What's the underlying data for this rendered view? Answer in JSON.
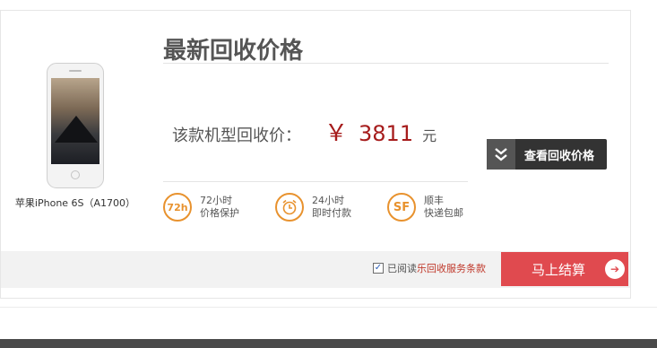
{
  "product": {
    "name": "苹果iPhone 6S（A1700）"
  },
  "title": "最新回收价格",
  "price": {
    "label": "该款机型回收价：",
    "symbol": "￥",
    "value": "3811",
    "unit": "元"
  },
  "check_button": {
    "icon": "double-chevron-down-icon",
    "label": "查看回收价格"
  },
  "features": [
    {
      "icon": "72h-icon",
      "icon_text": "72h",
      "line1": "72小时",
      "line2": "价格保护"
    },
    {
      "icon": "alarm-clock-icon",
      "icon_text": "⏰",
      "line1": "24小时",
      "line2": "即时付款"
    },
    {
      "icon": "sf-express-icon",
      "icon_text": "SF",
      "line1": "顺丰",
      "line2": "快递包邮"
    }
  ],
  "agreement": {
    "checked": true,
    "text": "已阅读",
    "link": "乐回收服务条款"
  },
  "settle_button": {
    "label": "马上结算",
    "icon": "arrow-right-circle-icon"
  },
  "colors": {
    "accent": "#e04a4f",
    "price": "#a61c1c",
    "feature": "#e8922e",
    "dark_button": "#333333"
  }
}
